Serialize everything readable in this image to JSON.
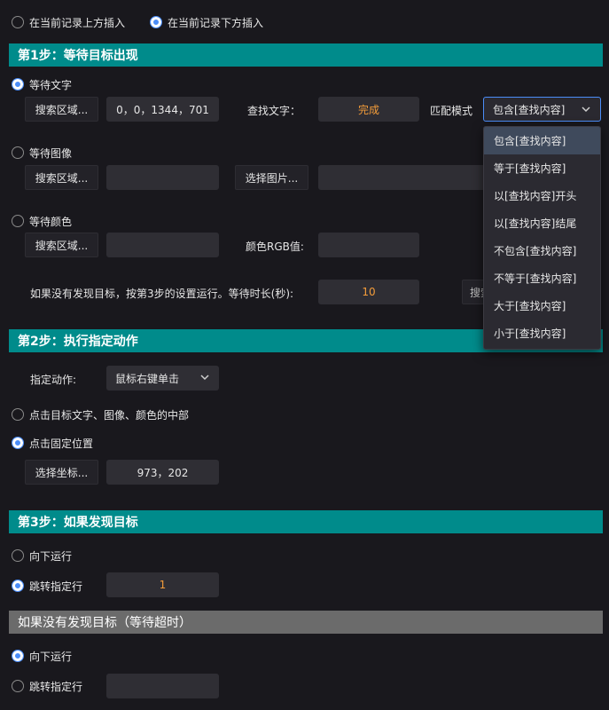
{
  "insert_options": {
    "above": "在当前记录上方插入",
    "below": "在当前记录下方插入"
  },
  "step1": {
    "title": "第1步：等待目标出现",
    "wait_text": {
      "label": "等待文字",
      "search_area_button": "搜索区域...",
      "search_area_value": "0，0，1344，701",
      "find_text_label": "查找文字：",
      "find_text_value": "完成",
      "match_mode_label": "匹配模式",
      "match_mode_value": "包含[查找内容]"
    },
    "wait_image": {
      "label": "等待图像",
      "search_area_button": "搜索区域...",
      "search_area_value": "",
      "select_image_button": "选择图片...",
      "image_value": ""
    },
    "wait_color": {
      "label": "等待颜色",
      "search_area_button": "搜索区域...",
      "search_area_value": "",
      "rgb_label": "颜色RGB值:",
      "rgb_value": ""
    },
    "timeout_text": "如果没有发现目标，按第3步的设置运行。等待时长(秒):",
    "timeout_value": "10",
    "partial_button": "搜索"
  },
  "match_mode_options": [
    "包含[查找内容]",
    "等于[查找内容]",
    "以[查找内容]开头",
    "以[查找内容]结尾",
    "不包含[查找内容]",
    "不等于[查找内容]",
    "大于[查找内容]",
    "小于[查找内容]"
  ],
  "step2": {
    "title": "第2步：执行指定动作",
    "action_label": "指定动作:",
    "action_value": "鼠标右键单击",
    "click_center_label": "点击目标文字、图像、颜色的中部",
    "click_fixed_label": "点击固定位置",
    "select_coord_button": "选择坐标...",
    "coord_value": "973，202"
  },
  "step3": {
    "title": "第3步：如果发现目标",
    "run_down_label": "向下运行",
    "jump_label": "跳转指定行",
    "jump_value": "1"
  },
  "timeout_section": {
    "title": "如果没有发现目标（等待超时）",
    "run_down_label": "向下运行",
    "jump_label": "跳转指定行",
    "jump_value": ""
  },
  "colors": {
    "accent": "#008b8b",
    "radio_selected": "#4b8df8",
    "value_orange": "#f39c3a",
    "background": "#19181d"
  }
}
